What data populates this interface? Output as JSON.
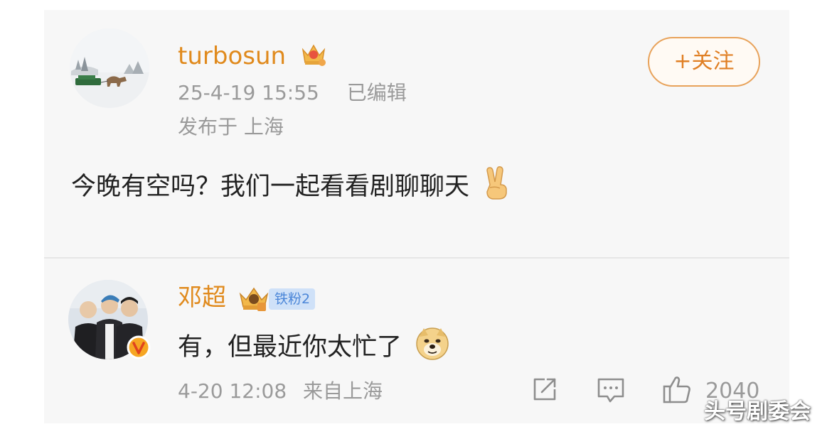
{
  "post": {
    "username": "turbosun",
    "timestamp": "25-4-19 15:55",
    "edited_label": "已编辑",
    "location": "发布于 上海",
    "follow_label": "+关注",
    "content": "今晚有空吗？我们一起看看剧聊聊天",
    "content_emoji": "victory-hand-emoji"
  },
  "reply": {
    "username": "邓超",
    "fan_badge": "铁粉2",
    "verified_icon": "verified-v-badge",
    "content": "有，但最近你太忙了",
    "content_emoji": "doge-emoji",
    "timestamp": "4-20 12:08",
    "source": "来自上海",
    "like_count": "2040"
  },
  "watermark": "头号剧委会",
  "colors": {
    "name": "#e08a1d",
    "meta": "#9a9a9a",
    "follow_border": "#e8a25a",
    "card_bg": "#f7f7f7"
  }
}
